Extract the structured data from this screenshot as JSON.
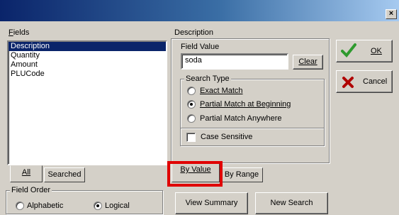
{
  "window": {
    "close_glyph": "×"
  },
  "fields_panel": {
    "label": "Fields",
    "items": [
      "Description",
      "Quantity",
      "Amount",
      "PLUCode"
    ],
    "selected_index": 0,
    "tabs": [
      "All",
      "Searched"
    ],
    "active_tab": "All"
  },
  "field_order": {
    "label": "Field Order",
    "options": [
      "Alphabetic",
      "Logical"
    ],
    "selected": "Logical"
  },
  "description_panel": {
    "label": "Description",
    "field_value_label": "Field Value",
    "field_value": "soda",
    "clear_button": "Clear",
    "search_type": {
      "label": "Search Type",
      "options": [
        "Exact Match",
        "Partial Match at Beginning",
        "Partial Match Anywhere"
      ],
      "selected": "Partial Match at Beginning"
    },
    "case_sensitive_label": "Case Sensitive",
    "case_sensitive_checked": false,
    "tabs": [
      "By Value",
      "By Range"
    ],
    "active_tab": "By Value"
  },
  "buttons": {
    "ok": "OK",
    "cancel": "Cancel",
    "view_summary": "View Summary",
    "new_search": "New Search"
  },
  "colors": {
    "title_gradient_start": "#0a246a",
    "selection": "#0a246a",
    "highlight_box": "#e00000",
    "ok_check": "#2e9a2e",
    "cancel_x": "#b00000"
  },
  "icons": {
    "ok": "check-icon",
    "cancel": "x-icon"
  }
}
